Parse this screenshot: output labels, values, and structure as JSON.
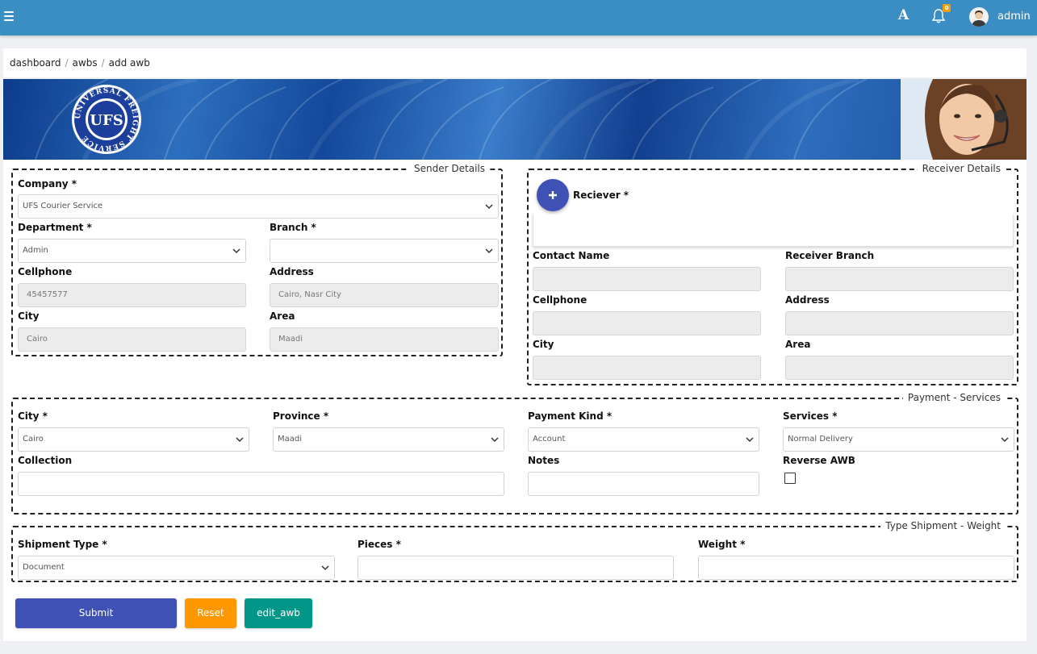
{
  "topbar": {
    "font_icon_glyph": "A",
    "notification_count": "0",
    "user_name": "admin"
  },
  "breadcrumb": {
    "items": [
      "dashboard",
      "awbs",
      "add awb"
    ],
    "separator": "/"
  },
  "banner": {
    "logo_text": "UFS",
    "logo_ring_text": "UNIVERSAL FREIGHT SERVICE"
  },
  "sender": {
    "legend": "Sender Details",
    "company_label": "Company *",
    "company_value": "UFS Courier Service",
    "department_label": "Department *",
    "department_value": "Admin",
    "branch_label": "Branch *",
    "branch_value": "",
    "cellphone_label": "Cellphone",
    "cellphone_value": "45457577",
    "address_label": "Address",
    "address_value": "Cairo, Nasr City",
    "city_label": "City",
    "city_value": "Cairo",
    "area_label": "Area",
    "area_value": "Maadi"
  },
  "receiver": {
    "legend": "Receiver Details",
    "receiver_label": "Reciever *",
    "receiver_value": "",
    "contact_name_label": "Contact Name",
    "receiver_branch_label": "Receiver Branch",
    "cellphone_label": "Cellphone",
    "address_label": "Address",
    "city_label": "City",
    "area_label": "Area"
  },
  "payment": {
    "legend": "Payment - Services",
    "city_label": "City *",
    "city_value": "Cairo",
    "province_label": "Province *",
    "province_value": "Maadi",
    "payment_kind_label": "Payment Kind *",
    "payment_kind_value": "Account",
    "services_label": "Services *",
    "services_value": "Normal Delivery",
    "collection_label": "Collection",
    "notes_label": "Notes",
    "reverse_awb_label": "Reverse AWB",
    "reverse_awb_checked": false
  },
  "shipment": {
    "legend": "Type Shipment - Weight",
    "type_label": "Shipment Type *",
    "type_value": "Document",
    "pieces_label": "Pieces *",
    "weight_label": "Weight *"
  },
  "actions": {
    "submit_label": "Submit",
    "reset_label": "Reset",
    "edit_label": "edit_awb"
  },
  "colors": {
    "topbar": "#3b8ec3",
    "submit": "#3f51b5",
    "reset": "#ff9800",
    "edit": "#009688",
    "badge": "#f59e0b"
  }
}
